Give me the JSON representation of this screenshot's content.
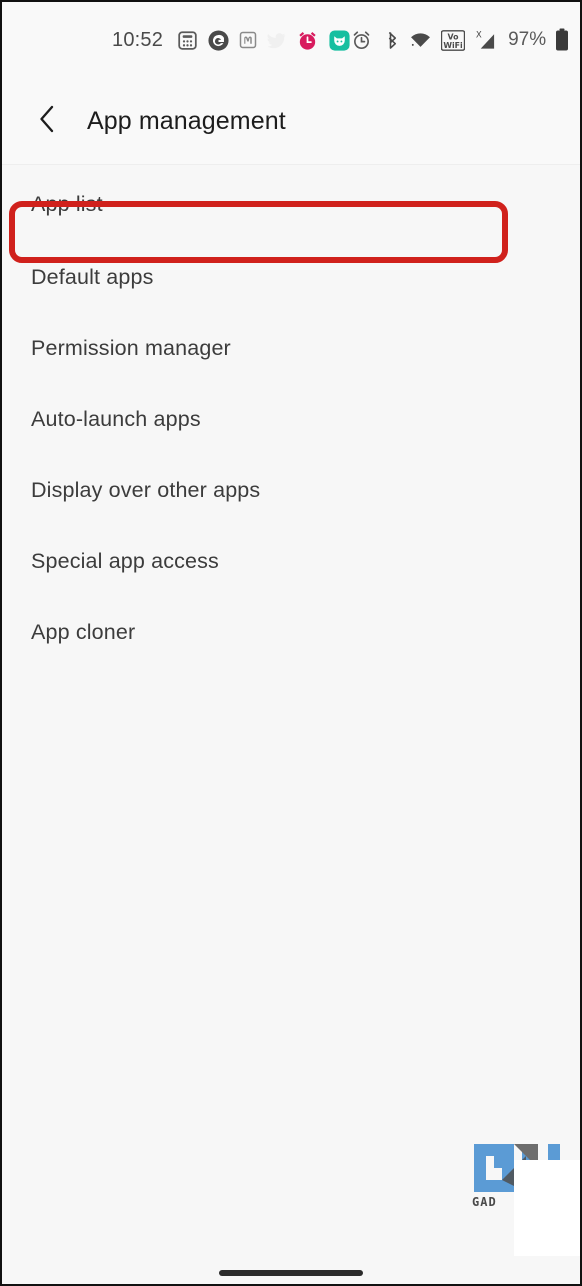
{
  "status_bar": {
    "time": "10:52",
    "battery_percent": "97%",
    "left_icons": [
      {
        "name": "calculator-icon",
        "label": "Calculator"
      },
      {
        "name": "grammarly-icon",
        "label": "G"
      },
      {
        "name": "mastodon-icon",
        "label": "m"
      },
      {
        "name": "twitter-icon",
        "label": "Twitter"
      },
      {
        "name": "alarm-app-icon",
        "label": "Alarm"
      },
      {
        "name": "mi-home-icon",
        "label": "Mi Home"
      }
    ],
    "right_icons": [
      {
        "name": "alarm-clock-icon",
        "label": "Alarm set"
      },
      {
        "name": "bluetooth-icon",
        "label": "Bluetooth"
      },
      {
        "name": "wifi-icon",
        "label": "Wi-Fi"
      },
      {
        "name": "vowifi-icon",
        "label": "VoWiFi"
      },
      {
        "name": "cellular-signal-icon",
        "label": "No SIM signal"
      },
      {
        "name": "battery-icon",
        "label": "Battery"
      }
    ],
    "colors": {
      "alarm_app": "#d81b5e",
      "mi_home": "#16bfa0",
      "twitter": "#f2f2f2",
      "text": "#4a4a4a"
    }
  },
  "header": {
    "back_icon": "chevron-left-icon",
    "title": "App management"
  },
  "list": {
    "items": [
      {
        "label": "App list",
        "highlighted": true
      },
      {
        "label": "Default apps",
        "highlighted": false
      },
      {
        "label": "Permission manager",
        "highlighted": false
      },
      {
        "label": "Auto-launch apps",
        "highlighted": false
      },
      {
        "label": "Display over other apps",
        "highlighted": false
      },
      {
        "label": "Special app access",
        "highlighted": false
      },
      {
        "label": "App cloner",
        "highlighted": false
      }
    ]
  },
  "highlight": {
    "target": "App list",
    "color": "#d0211c"
  },
  "watermark": {
    "text": "GAD",
    "logo_color": "#5b9bd5"
  },
  "navigation": {
    "home_indicator": "home-gesture-bar"
  }
}
